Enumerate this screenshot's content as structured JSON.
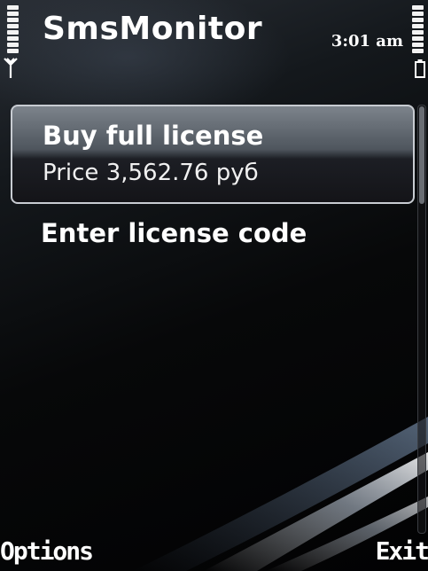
{
  "status_bar": {
    "app_title": "SmsMonitor",
    "time": "3:01 am"
  },
  "list": {
    "items": [
      {
        "title": "Buy full license",
        "subtitle": "Price 3,562.76 руб",
        "selected": true
      },
      {
        "title": "Enter license code"
      }
    ]
  },
  "softkeys": {
    "left": "Options",
    "right": "Exit"
  },
  "colors": {
    "background": "#000000",
    "text": "#ffffff",
    "highlight_border": "#c8ccd2"
  },
  "icons": {
    "signal": "antenna-icon",
    "battery": "battery-icon"
  }
}
